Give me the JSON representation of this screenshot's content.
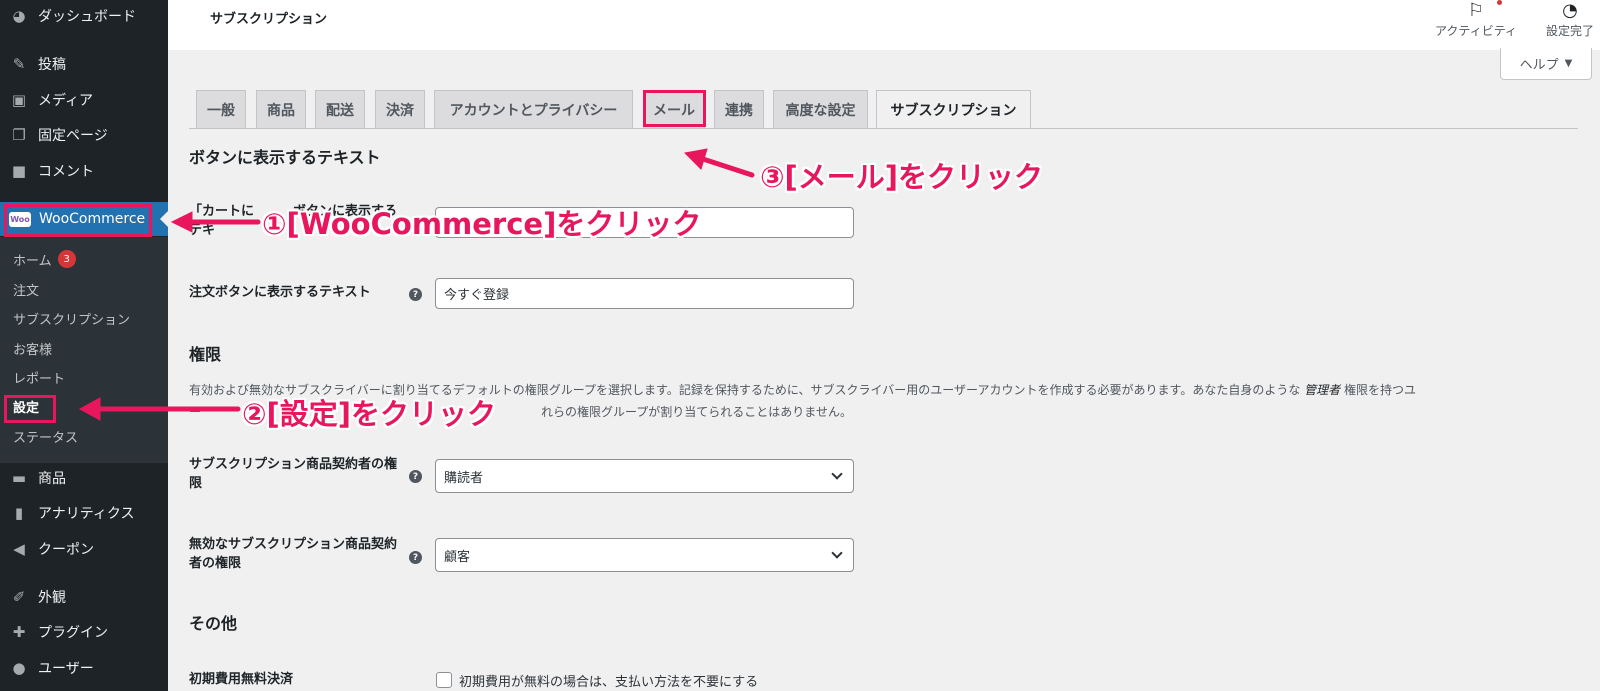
{
  "sidebar": {
    "items": [
      {
        "label": "ダッシュボード",
        "icon": "dashboard-icon",
        "glyph": "◕"
      },
      {
        "label": "投稿",
        "icon": "pin-icon",
        "glyph": "✎"
      },
      {
        "label": "メディア",
        "icon": "media-icon",
        "glyph": "▣"
      },
      {
        "label": "固定ページ",
        "icon": "pages-icon",
        "glyph": "❐"
      },
      {
        "label": "コメント",
        "icon": "comment-icon",
        "glyph": "■"
      },
      {
        "label": "WooCommerce",
        "icon": "woocommerce-icon",
        "glyph": "Woo"
      },
      {
        "label": "商品",
        "icon": "products-icon",
        "glyph": "▬"
      },
      {
        "label": "アナリティクス",
        "icon": "analytics-icon",
        "glyph": "▮"
      },
      {
        "label": "クーポン",
        "icon": "coupon-icon",
        "glyph": "◀"
      },
      {
        "label": "外観",
        "icon": "appearance-icon",
        "glyph": "✐"
      },
      {
        "label": "プラグイン",
        "icon": "plugin-icon",
        "glyph": "✚"
      },
      {
        "label": "ユーザー",
        "icon": "user-icon",
        "glyph": "●"
      }
    ],
    "submenu": [
      {
        "label": "ホーム",
        "badge": "3"
      },
      {
        "label": "注文"
      },
      {
        "label": "サブスクリプション"
      },
      {
        "label": "お客様"
      },
      {
        "label": "レポート"
      },
      {
        "label": "設定"
      },
      {
        "label": "ステータス"
      }
    ]
  },
  "header": {
    "title": "サブスクリプション",
    "activity_label": "アクティビティ",
    "setup_label": "設定完了",
    "help_label": "ヘルプ"
  },
  "tabs": [
    "一般",
    "商品",
    "配送",
    "決済",
    "アカウントとプライバシー",
    "メール",
    "連携",
    "高度な設定",
    "サブスクリプション"
  ],
  "form": {
    "section_button_text": "ボタンに表示するテキスト",
    "cart_label": "「カートに　　　ボタンに表示するテキ",
    "order_label": "注文ボタンに表示するテキスト",
    "order_value": "今すぐ登録",
    "section_roles": "権限",
    "roles_desc_line1_a": "有効および無効なサブスクライバーに割り当てるデフォルトの権限グループを選択します。記録を保持するために、サブスクライバー用のユーザーアカウントを作成する必要があります。あなた自身のような",
    "roles_desc_line1_em": "管理者",
    "roles_desc_line1_b": "権限を持つユ",
    "roles_desc_line2_a": "ー",
    "roles_desc_line2_b": "れらの権限グループが割り当てられることはありません。",
    "subscriber_role_label": "サブスクリプション商品契約者の権限",
    "subscriber_role_value": "購読者",
    "inactive_role_label": "無効なサブスクリプション商品契約者の権限",
    "inactive_role_value": "顧客",
    "section_misc": "その他",
    "free_trial_label": "初期費用無料決済",
    "free_trial_checkbox_label": "初期費用が無料の場合は、支払い方法を不要にする"
  },
  "annotations": {
    "step1": "①[WooCommerce]をクリック",
    "step2": "②[設定]をクリック",
    "step3": "③[メール]をクリック"
  },
  "colors": {
    "sidebar_bg": "#1d2327",
    "accent": "#2271b1",
    "annotation": "#e8175d"
  }
}
